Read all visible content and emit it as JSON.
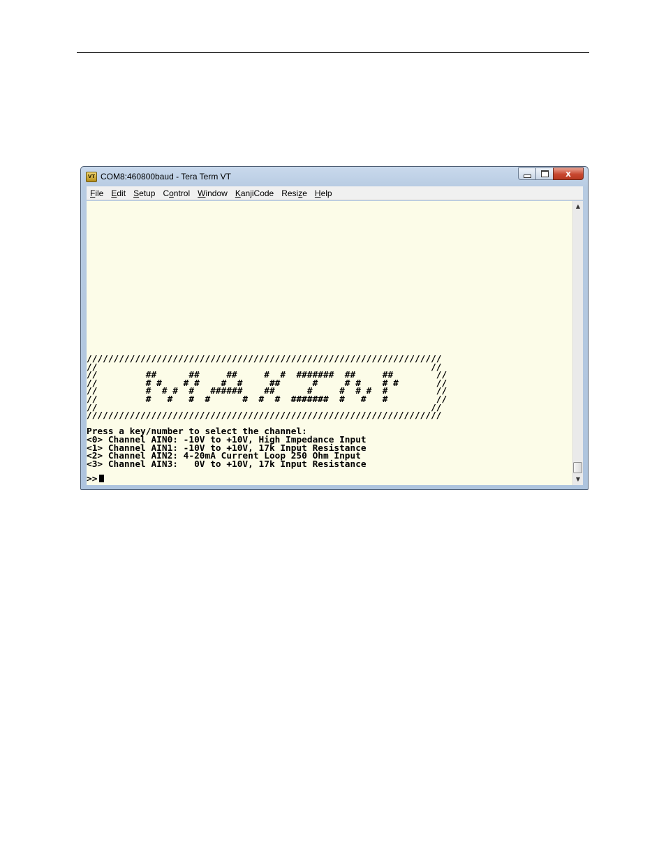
{
  "window": {
    "title": "COM8:460800baud - Tera Term VT",
    "icon_label": "VT",
    "buttons": {
      "close_glyph": "x"
    }
  },
  "menu": {
    "items": [
      {
        "key": "F",
        "rest": "ile"
      },
      {
        "key": "E",
        "rest": "dit"
      },
      {
        "key": "S",
        "rest": "etup"
      },
      {
        "pre": "C",
        "key": "o",
        "rest": "ntrol"
      },
      {
        "key": "W",
        "rest": "indow"
      },
      {
        "key": "K",
        "rest": "anjiCode"
      },
      {
        "pre": "Resi",
        "key": "z",
        "rest": "e"
      },
      {
        "key": "H",
        "rest": "elp"
      }
    ]
  },
  "terminal": {
    "banner": [
      "//////////////////////////////////////////////////////////////////",
      "//                                                              //",
      "//         ##      ##     ##     #  #  #######  ##     ##        //",
      "//         # #    # #    #  #     ##      #     # #    # #       //",
      "//         #  # #  #   ######    ##      #     #  # #  #         //",
      "//         #   #   #  #      #  #  #  #######  #   #   #         //",
      "//                                                              //",
      "//////////////////////////////////////////////////////////////////"
    ],
    "menu_lines": [
      "Press a key/number to select the channel:",
      "<0> Channel AIN0: -10V to +10V, High Impedance Input",
      "<1> Channel AIN1: -10V to +10V, 17k Input Resistance",
      "<2> Channel AIN2: 4-20mA Current Loop 250 Ohm Input",
      "<3> Channel AIN3:   0V to +10V, 17k Input Resistance"
    ],
    "prompt": ">>"
  },
  "scrollbar": {
    "up_glyph": "▲",
    "down_glyph": "▼"
  }
}
